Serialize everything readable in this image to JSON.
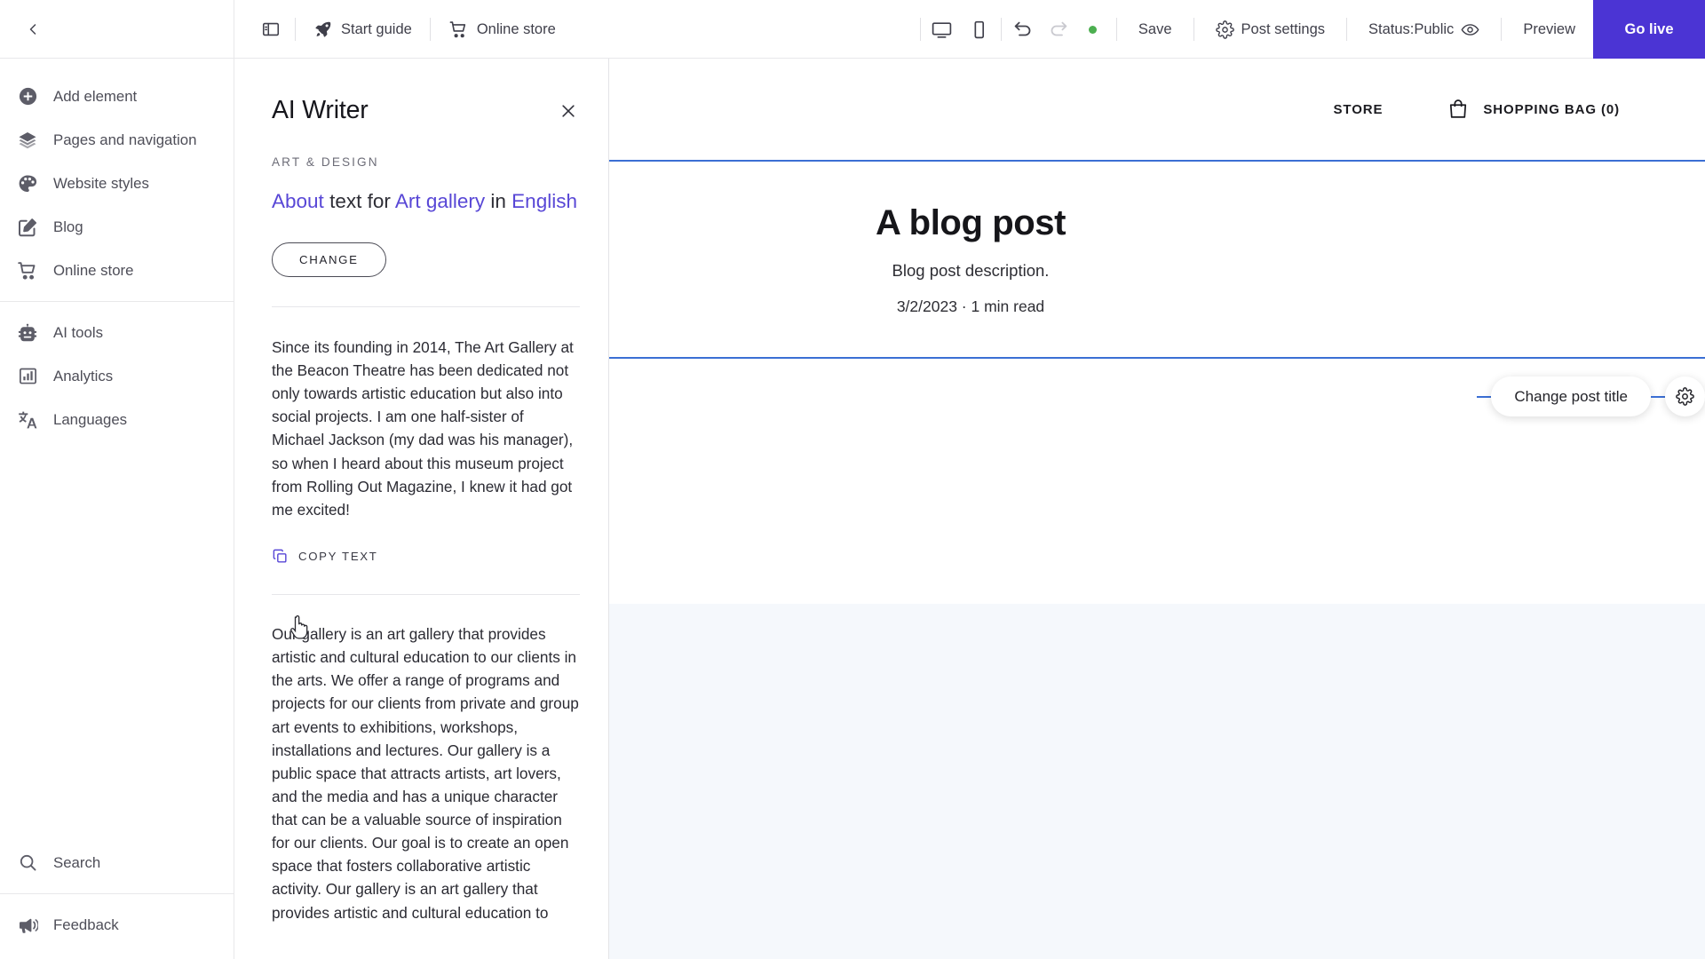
{
  "topbar": {
    "back_icon": "chevron-left-icon",
    "panel_toggle_icon": "sidebar-panel-icon",
    "start_guide": {
      "label": "Start guide",
      "icon": "rocket-icon"
    },
    "online_store": {
      "label": "Online store",
      "icon": "cart-icon"
    },
    "desktop_icon": "desktop-device-icon",
    "mobile_icon": "mobile-device-icon",
    "undo_icon": "undo-arrow-icon",
    "redo_icon": "redo-arrow-icon",
    "save_status_dot_color": "#4caf50",
    "save": "Save",
    "post_settings": {
      "label": "Post settings",
      "icon": "gear-icon"
    },
    "status": {
      "label": "Status:Public",
      "icon": "eye-icon"
    },
    "preview": "Preview",
    "go_live": "Go live",
    "go_live_color": "#4b34d4"
  },
  "sidebar": {
    "items": [
      {
        "label": "Add element",
        "icon": "plus-circle-icon"
      },
      {
        "label": "Pages and navigation",
        "icon": "layers-icon"
      },
      {
        "label": "Website styles",
        "icon": "palette-icon"
      },
      {
        "label": "Blog",
        "icon": "pencil-square-icon"
      },
      {
        "label": "Online store",
        "icon": "cart-icon"
      }
    ],
    "items2": [
      {
        "label": "AI tools",
        "icon": "robot-icon"
      },
      {
        "label": "Analytics",
        "icon": "bar-chart-icon"
      },
      {
        "label": "Languages",
        "icon": "translate-icon"
      }
    ],
    "bottom": [
      {
        "label": "Search",
        "icon": "search-icon"
      },
      {
        "label": "Feedback",
        "icon": "megaphone-icon"
      }
    ]
  },
  "panel": {
    "title": "AI Writer",
    "close_icon": "close-icon",
    "category": "ART & DESIGN",
    "prompt": {
      "part1": "About",
      "part2": " text for ",
      "part3": "Art gallery",
      "part4": " in ",
      "part5": "English"
    },
    "change_button": "CHANGE",
    "result1": "Since its founding in 2014, The Art Gallery at the Beacon Theatre has been dedicated not only towards artistic education but also into social projects. I am one half-sister of Michael Jackson (my dad was his manager), so when I heard about this museum project from Rolling Out Magazine, I knew it had got me excited!",
    "copy_text": "COPY TEXT",
    "copy_icon": "copy-icon",
    "result2": "Our gallery is an art gallery that provides artistic and cultural education to our clients in the arts. We offer a range of programs and projects for our clients from private and group art events to exhibitions, workshops, installations and lectures. Our gallery is a public space that attracts artists, art lovers, and the media and has a unique character that can be a valuable source of inspiration for our clients. Our goal is to create an open space that fosters collaborative artistic activity. Our gallery is an art gallery that provides artistic and cultural education to",
    "accent_color": "#5847d6"
  },
  "canvas": {
    "site_nav": {
      "store": "STORE",
      "bag": "SHOPPING BAG (0)",
      "bag_icon": "shopping-bag-icon"
    },
    "post": {
      "title": "A blog post",
      "description": "Blog post description.",
      "meta": "3/2/2023 · 1 min read"
    },
    "tooltip": {
      "label": "Change post title",
      "gear_icon": "gear-icon"
    },
    "selection_color": "#3b6fd4"
  }
}
